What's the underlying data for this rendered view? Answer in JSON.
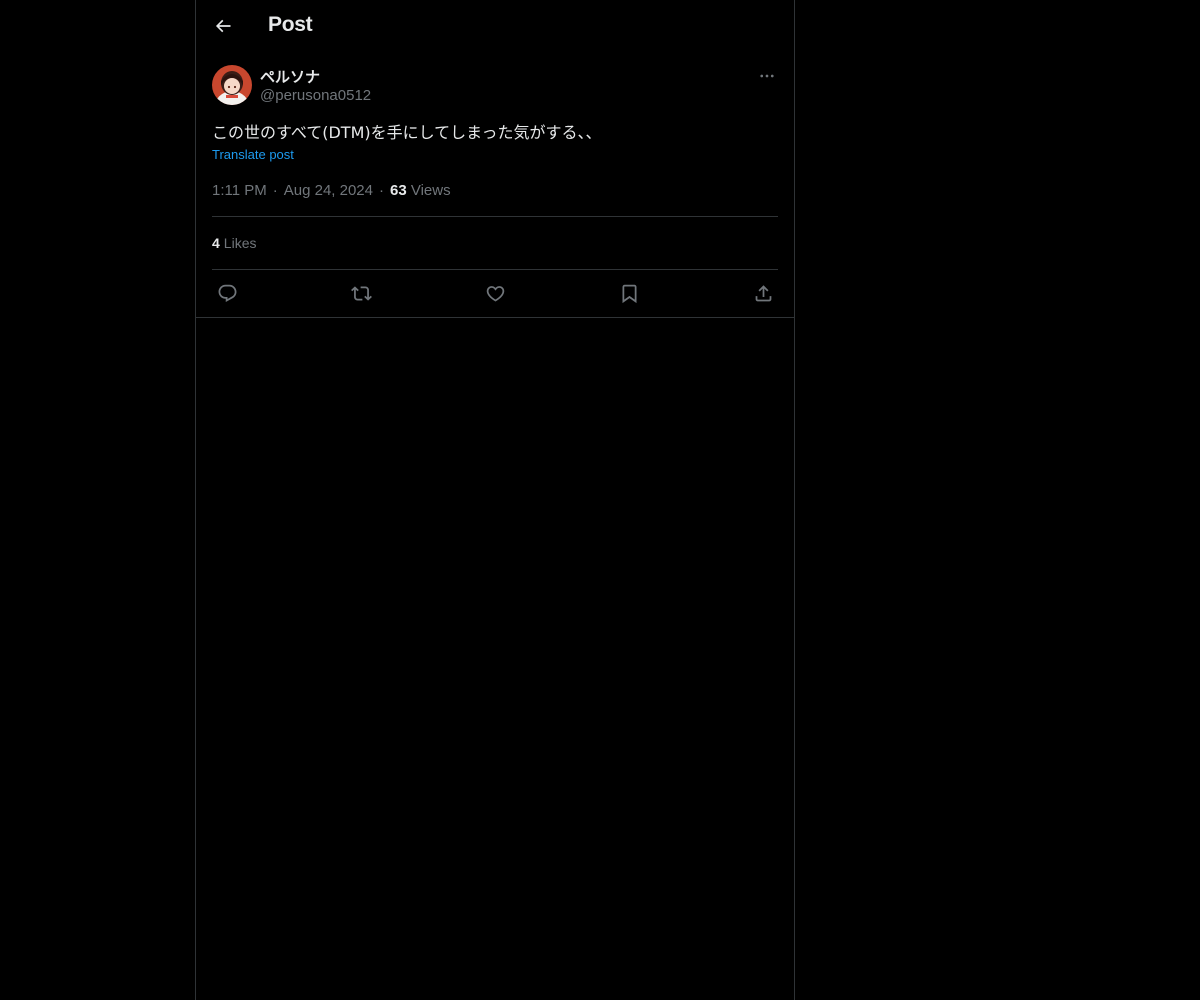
{
  "header": {
    "title": "Post",
    "back_icon": "arrow-left-icon"
  },
  "post": {
    "author": {
      "name": "ペルソナ",
      "handle": "@perusona0512"
    },
    "text": "この世のすべて(DTM)を手にしてしまった気がする、、",
    "translate_label": "Translate post",
    "time": "1:11 PM",
    "date": "Aug 24, 2024",
    "views_count": "63",
    "views_label": "Views",
    "likes_count": "4",
    "likes_label": "Likes"
  },
  "actions": [
    "reply-icon",
    "repost-icon",
    "like-icon",
    "bookmark-icon",
    "share-icon"
  ],
  "colors": {
    "background": "#000000",
    "border": "#2f3336",
    "text_primary": "#e7e9ea",
    "text_secondary": "#71767b",
    "link": "#1d9bf0"
  }
}
